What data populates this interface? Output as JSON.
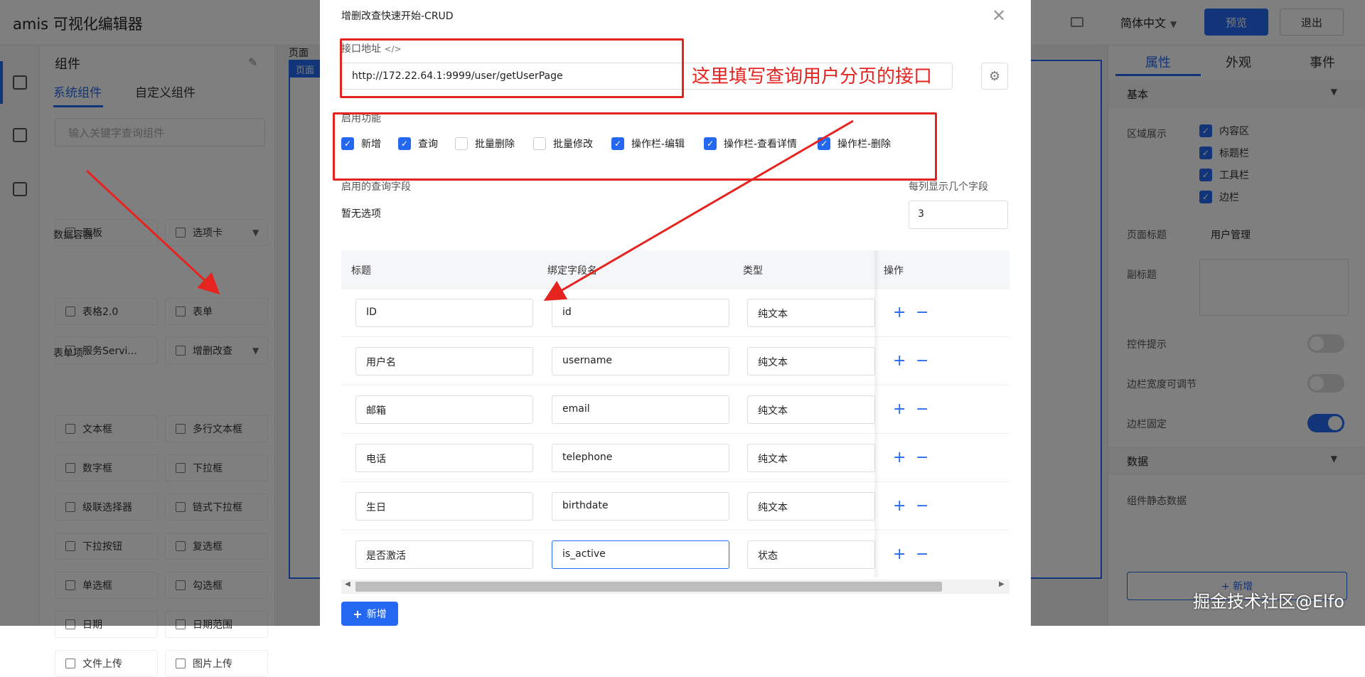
{
  "app": {
    "title": "amis 可视化编辑器",
    "language": "简体中文",
    "preview_label": "预览",
    "exit_label": "退出"
  },
  "component_panel": {
    "header": "组件",
    "tabs": [
      "系统组件",
      "自定义组件"
    ],
    "search_placeholder": "输入关键字查询组件",
    "top_items": [
      "面板",
      "选项卡"
    ],
    "groups": [
      {
        "label": "数据容器",
        "items": [
          "表格2.0",
          "表单",
          "服务Servi...",
          "增删改查"
        ]
      },
      {
        "label": "表单项",
        "items": [
          "文本框",
          "多行文本框",
          "数字框",
          "下拉框",
          "级联选择器",
          "链式下拉框",
          "下拉按钮",
          "复选框",
          "单选框",
          "勾选框",
          "日期",
          "日期范围",
          "文件上传",
          "图片上传"
        ]
      }
    ]
  },
  "canvas": {
    "page_label": "页面",
    "page_tag": "页面"
  },
  "right_panel": {
    "tabs": [
      "属性",
      "外观",
      "事件"
    ],
    "section_basic": "基本",
    "region_label": "区域展示",
    "regions": [
      "内容区",
      "标题栏",
      "工具栏",
      "边栏"
    ],
    "page_title_label": "页面标题",
    "page_title_value": "用户管理",
    "subtitle_label": "副标题",
    "toggles": [
      {
        "label": "控件提示",
        "on": false
      },
      {
        "label": "边栏宽度可调节",
        "on": false
      },
      {
        "label": "边栏固定",
        "on": true
      }
    ],
    "section_data": "数据",
    "static_data_label": "组件静态数据",
    "add_label": "+ 新增"
  },
  "modal": {
    "title": "增删改查快速开始-CRUD",
    "api_label": "接口地址",
    "api_value": "http://172.22.64.1:9999/user/getUserPage",
    "features_label": "启用功能",
    "features": [
      {
        "label": "新增",
        "checked": true
      },
      {
        "label": "查询",
        "checked": true
      },
      {
        "label": "批量删除",
        "checked": false
      },
      {
        "label": "批量修改",
        "checked": false
      },
      {
        "label": "操作栏-编辑",
        "checked": true
      },
      {
        "label": "操作栏-查看详情",
        "checked": true
      },
      {
        "label": "操作栏-删除",
        "checked": true
      }
    ],
    "query_fields_label": "启用的查询字段",
    "query_fields_empty": "暂无选项",
    "per_row_label": "每列显示几个字段",
    "per_row_value": "3",
    "columns": [
      "标题",
      "绑定字段名",
      "类型",
      "操作"
    ],
    "rows": [
      {
        "title": "ID",
        "field": "id",
        "type": "纯文本"
      },
      {
        "title": "用户名",
        "field": "username",
        "type": "纯文本"
      },
      {
        "title": "邮箱",
        "field": "email",
        "type": "纯文本"
      },
      {
        "title": "电话",
        "field": "telephone",
        "type": "纯文本"
      },
      {
        "title": "生日",
        "field": "birthdate",
        "type": "纯文本"
      },
      {
        "title": "是否激活",
        "field": "is_active",
        "type": "状态"
      }
    ],
    "add_button": "新增"
  },
  "annotation": {
    "text": "这里填写查询用户分页的接口",
    "color": "#e52420"
  },
  "watermark": "掘金技术社区@Elfo",
  "colors": {
    "primary": "#2468f2"
  }
}
